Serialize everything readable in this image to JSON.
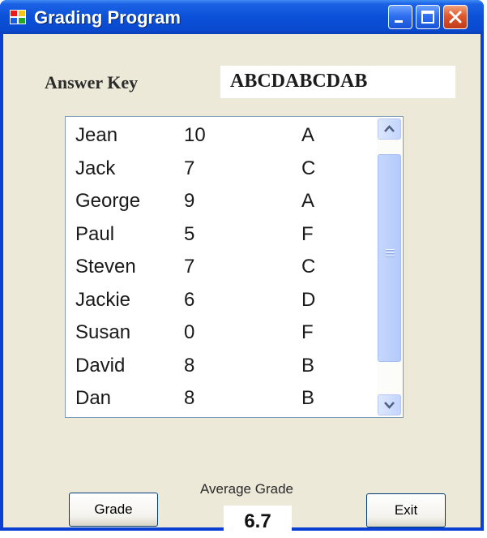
{
  "window": {
    "title": "Grading Program",
    "titlebar_color": "#0b51d8",
    "client_background": "#ece9d8",
    "buttons": [
      {
        "name": "minimize",
        "icon": "minimize-icon"
      },
      {
        "name": "maximize",
        "icon": "maximize-icon"
      },
      {
        "name": "close",
        "icon": "close-icon"
      }
    ]
  },
  "answer_key": {
    "label": "Answer Key",
    "value": "ABCDABCDAB"
  },
  "students": {
    "rows": [
      {
        "name": "Jean",
        "score": "10",
        "grade": "A"
      },
      {
        "name": "Jack",
        "score": "7",
        "grade": "C"
      },
      {
        "name": "George",
        "score": "9",
        "grade": "A"
      },
      {
        "name": "Paul",
        "score": "5",
        "grade": "F"
      },
      {
        "name": "Steven",
        "score": "7",
        "grade": "C"
      },
      {
        "name": "Jackie",
        "score": "6",
        "grade": "D"
      },
      {
        "name": "Susan",
        "score": "0",
        "grade": "F"
      },
      {
        "name": "David",
        "score": "8",
        "grade": "B"
      },
      {
        "name": "Dan",
        "score": "8",
        "grade": "B"
      }
    ]
  },
  "actions": {
    "grade_label": "Grade",
    "exit_label": "Exit"
  },
  "average": {
    "label": "Average Grade",
    "value": "6.7"
  }
}
